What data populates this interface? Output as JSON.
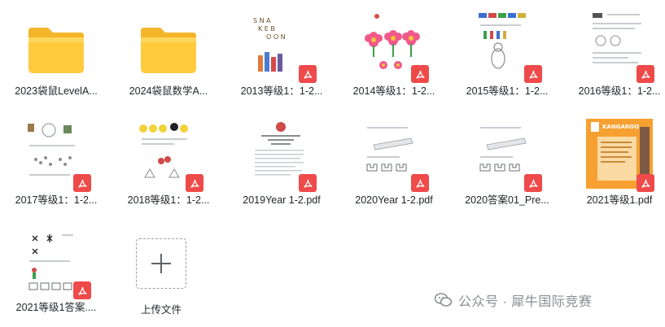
{
  "files": [
    {
      "name": "2023袋鼠LevelA...",
      "kind": "folder"
    },
    {
      "name": "2024袋鼠数学A...",
      "kind": "folder"
    },
    {
      "name": "2013等级1：1-2...",
      "kind": "pdf"
    },
    {
      "name": "2014等级1：1-2...",
      "kind": "pdf"
    },
    {
      "name": "2015等级1：1-2...",
      "kind": "pdf"
    },
    {
      "name": "2016等级1：1-2...",
      "kind": "pdf"
    },
    {
      "name": "2017等级1：1-2...",
      "kind": "pdf"
    },
    {
      "name": "2018等级1：1-2...",
      "kind": "pdf"
    },
    {
      "name": "2019Year 1-2.pdf",
      "kind": "pdf"
    },
    {
      "name": "2020Year 1-2.pdf",
      "kind": "pdf"
    },
    {
      "name": "2020答案01_Pre...",
      "kind": "pdf"
    },
    {
      "name": "2021等级1.pdf",
      "kind": "pdf"
    },
    {
      "name": "2021等级1答案....",
      "kind": "pdf"
    }
  ],
  "upload": {
    "label": "上传文件",
    "icon": "plus-icon"
  },
  "watermark": {
    "text": "公众号 · 犀牛国际竞赛",
    "icon": "wechat-icon"
  },
  "thumb_art": {
    "kangaroo_text": "KANGAROO",
    "flower_color": "#f0588a",
    "pdf_badge_color": "#ef4a4a",
    "folder_color": "#ffc93a"
  }
}
